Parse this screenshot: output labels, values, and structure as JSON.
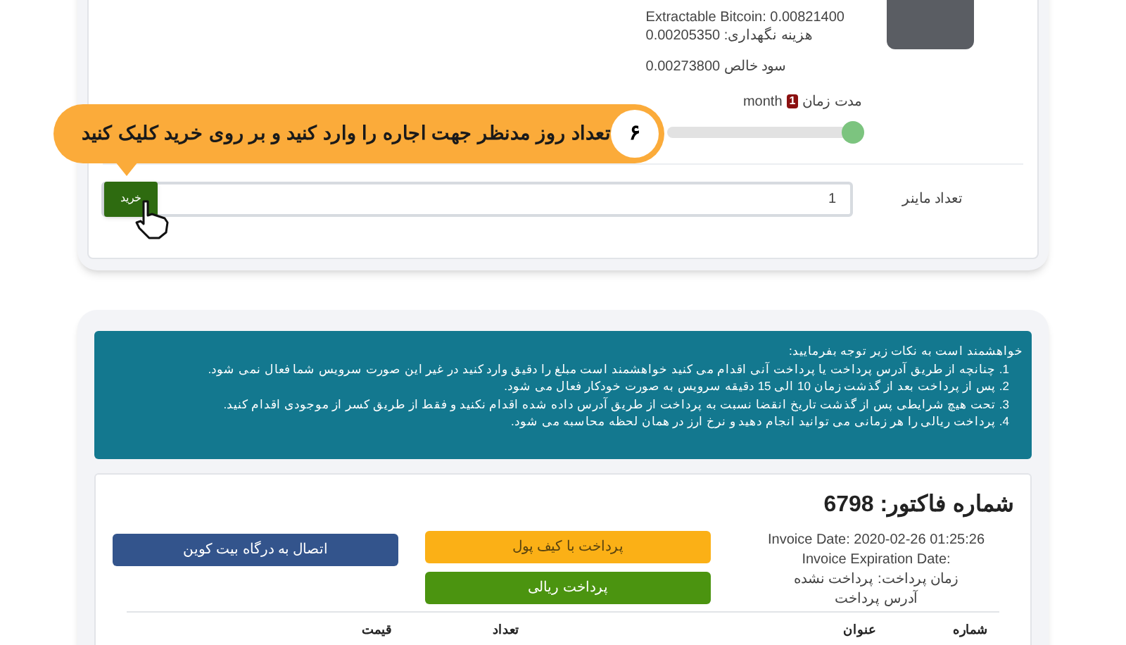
{
  "miner_details": {
    "lines": [
      "Extractable Bitcoin: 0.00821400",
      "هزینه نگهداری: 0.00205350"
    ],
    "net_profit": "سود خالص 0.00273800"
  },
  "duration": {
    "label": "مدت زمان",
    "badge": "1",
    "unit": "month",
    "level": 1
  },
  "tooltip": {
    "step": "۶",
    "text": "تعداد روز مدنظر جهت اجاره را وارد کنید و بر روی خرید کلیک کنید"
  },
  "quantity": {
    "label": "تعداد ماینر",
    "value": "1",
    "buy_button": "خرید"
  },
  "notice": {
    "heading": "خواهشمند است به نکات زیر توجه بفرمایید:",
    "items": [
      "1. چنانچه از طریق آدرس پرداخت یا پرداخت آنی اقدام می کنید خواهشمند است مبلغ را دقیق وارد کنید در غیر این صورت سرویس شما فعال نمی شود.",
      "2. پس از پرداخت بعد از گذشت زمان 10 الی 15 دقیقه سرویس به صورت خودکار فعال می شود.",
      "3. تحت هیچ شرایطی پس از گذشت تاریخ انقضا نسبت به پرداخت از طریق آدرس داده شده اقدام نکنید و فقط از طریق کسر از موجودی اقدام کنید.",
      "4. پرداخت ریالی را هر زمانی می توانید انجام دهید و نرخ ارز در همان لحظه محاسبه می شود."
    ]
  },
  "invoice": {
    "title": "شماره فاکتور: 6798",
    "info": [
      "Invoice Date: 2020-02-26 01:25:26",
      "Invoice Expiration Date:",
      "زمان پرداخت: پرداخت نشده",
      "آدرس پرداخت"
    ],
    "buttons": [
      {
        "label": "پرداخت با کیف پول",
        "kind": "wallet"
      },
      {
        "label": "پرداخت ریالی",
        "kind": "rial"
      },
      {
        "label": "اتصال به درگاه بیت کوین",
        "kind": "bitcoin"
      }
    ],
    "columns": [
      "شماره",
      "عنوان",
      "تعداد",
      "قیمت"
    ]
  }
}
